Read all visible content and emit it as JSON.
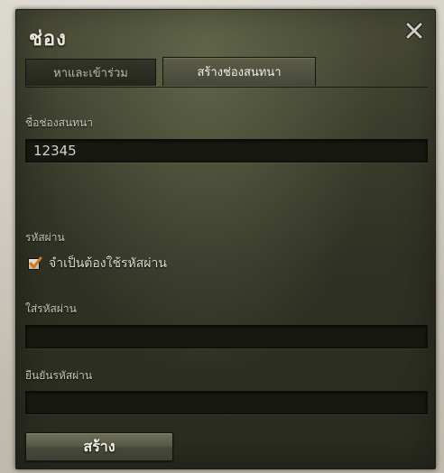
{
  "window": {
    "title": "ช่อง",
    "close_icon": "close-icon"
  },
  "tabs": [
    {
      "label": "หาและเข้าร่วม",
      "active": false
    },
    {
      "label": "สร้างช่องสนทนา",
      "active": true
    }
  ],
  "form": {
    "channel_name_label": "ชื่อช่องสนทนา",
    "channel_name_value": "12345",
    "password_section_label": "รหัสผ่าน",
    "require_password_label": "จำเป็นต้องใช้รหัสผ่าน",
    "require_password_checked": true,
    "enter_password_label": "ใส่รหัสผ่าน",
    "enter_password_value": "",
    "confirm_password_label": "ยืนยันรหัสผ่าน",
    "confirm_password_value": "",
    "create_button_label": "สร้าง"
  },
  "colors": {
    "panel_background": "#33352a",
    "checkbox_mark": "#d0781a",
    "field_background": "#17180f"
  }
}
